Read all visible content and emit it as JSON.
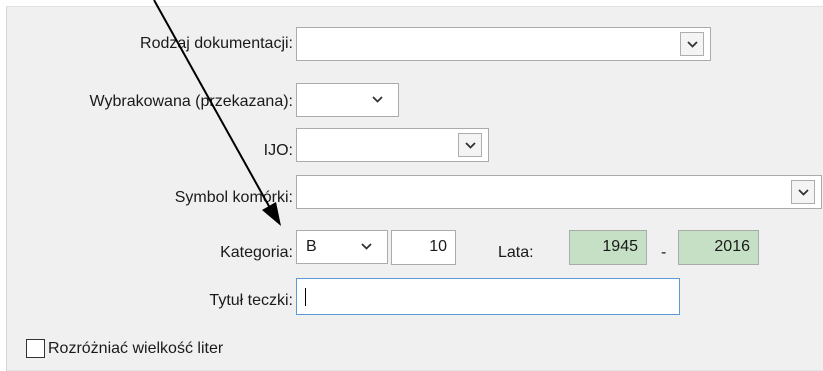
{
  "form": {
    "rodzaj": {
      "label": "Rodzaj dokumentacji:",
      "value": ""
    },
    "wybrakowana": {
      "label": "Wybrakowana (przekazana):",
      "value": ""
    },
    "ijo": {
      "label": "IJO:",
      "value": ""
    },
    "symbol": {
      "label": "Symbol komórki:",
      "value": ""
    },
    "kategoria": {
      "label": "Kategoria:",
      "value": "B",
      "number": "10"
    },
    "lata": {
      "label": "Lata:",
      "from": "1945",
      "separator": "-",
      "to": "2016"
    },
    "tytul": {
      "label": "Tytuł teczki:",
      "value": ""
    },
    "case_sensitive": {
      "label": "Rozróżniać wielkość liter",
      "checked": false
    }
  },
  "colors": {
    "year_field_bg": "#c6e0c5",
    "focus_border": "#5b9bd5"
  },
  "icons": {
    "dropdown": "chevron-down-icon",
    "annotation": "arrow-annotation"
  }
}
